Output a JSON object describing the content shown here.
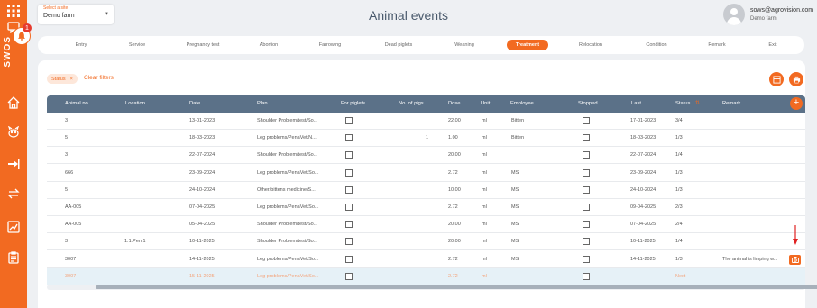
{
  "sidebar": {
    "brand": "SWOS",
    "notification_count": "1",
    "items": [
      {
        "name": "grid-icon"
      },
      {
        "name": "chat-icon"
      },
      {
        "name": "home-icon"
      },
      {
        "name": "pig-icon"
      },
      {
        "name": "sign-in-icon"
      },
      {
        "name": "transfer-icon"
      },
      {
        "name": "chart-icon"
      },
      {
        "name": "clipboard-icon"
      }
    ]
  },
  "header": {
    "site_select_label": "Select a site",
    "site_select_value": "Demo farm",
    "title": "Animal events",
    "user_email": "sows@agrovision.com",
    "user_farm": "Demo farm"
  },
  "tabs": [
    "Entry",
    "Service",
    "Pregnancy test",
    "Abortion",
    "Farrowing",
    "Dead piglets",
    "Weaning",
    "Treatment",
    "Relocation",
    "Condition",
    "Remark",
    "Exit"
  ],
  "active_tab": "Treatment",
  "filters": {
    "chip_label": "Status",
    "chip_close": "×",
    "clear_label": "Clear filters"
  },
  "table": {
    "columns": [
      "Animal no.",
      "Location",
      "Date",
      "Plan",
      "For piglets",
      "No. of pigs",
      "Dose",
      "Unit",
      "Employee",
      "Stopped",
      "Last",
      "Status",
      "Remark"
    ],
    "add_label": "+",
    "rows": [
      {
        "animal": "3",
        "location": "",
        "date": "13-01-2023",
        "plan": "Shoulder Problem/test/So...",
        "pigs": "",
        "dose": "22.00",
        "unit": "ml",
        "employee": "Bitten",
        "last": "17-01-2023",
        "status": "3/4",
        "remark": ""
      },
      {
        "animal": "5",
        "location": "",
        "date": "18-03-2023",
        "plan": "Leg problems/PenaVet/N...",
        "pigs": "1",
        "dose": "1.00",
        "unit": "ml",
        "employee": "Bitten",
        "last": "18-03-2023",
        "status": "1/3",
        "remark": ""
      },
      {
        "animal": "3",
        "location": "",
        "date": "22-07-2024",
        "plan": "Shoulder Problem/test/So...",
        "pigs": "",
        "dose": "20.00",
        "unit": "ml",
        "employee": "",
        "last": "22-07-2024",
        "status": "1/4",
        "remark": ""
      },
      {
        "animal": "666",
        "location": "",
        "date": "23-09-2024",
        "plan": "Leg problems/PenaVet/So...",
        "pigs": "",
        "dose": "2.72",
        "unit": "ml",
        "employee": "MS",
        "last": "23-09-2024",
        "status": "1/3",
        "remark": ""
      },
      {
        "animal": "5",
        "location": "",
        "date": "24-10-2024",
        "plan": "Other/bittens medicine/S...",
        "pigs": "",
        "dose": "10.00",
        "unit": "ml",
        "employee": "MS",
        "last": "24-10-2024",
        "status": "1/3",
        "remark": ""
      },
      {
        "animal": "AA-005",
        "location": "",
        "date": "07-04-2025",
        "plan": "Leg problems/PenaVet/So...",
        "pigs": "",
        "dose": "2.72",
        "unit": "ml",
        "employee": "MS",
        "last": "09-04-2025",
        "status": "2/3",
        "remark": ""
      },
      {
        "animal": "AA-005",
        "location": "",
        "date": "05-04-2025",
        "plan": "Shoulder Problem/test/So...",
        "pigs": "",
        "dose": "20.00",
        "unit": "ml",
        "employee": "MS",
        "last": "07-04-2025",
        "status": "2/4",
        "remark": ""
      },
      {
        "animal": "3",
        "location": "1.1.Pen.1",
        "date": "10-11-2025",
        "plan": "Shoulder Problem/test/So...",
        "pigs": "",
        "dose": "20.00",
        "unit": "ml",
        "employee": "MS",
        "last": "10-11-2025",
        "status": "1/4",
        "remark": ""
      },
      {
        "animal": "3007",
        "location": "",
        "date": "14-11-2025",
        "plan": "Leg problems/PenaVet/So...",
        "pigs": "",
        "dose": "2.72",
        "unit": "ml",
        "employee": "MS",
        "last": "14-11-2025",
        "status": "1/3",
        "remark": "The animal is limping w..."
      },
      {
        "animal": "3007",
        "location": "",
        "date": "15-11-2025",
        "plan": "Leg problems/PenaVet/So...",
        "pigs": "",
        "dose": "2.72",
        "unit": "ml",
        "employee": "",
        "last": "",
        "status": "Next",
        "remark": ""
      }
    ]
  },
  "colors": {
    "accent": "#f26a21",
    "header_row": "#5b7188",
    "highlight_row": "#e6f1f7",
    "arrow": "#e02020"
  }
}
